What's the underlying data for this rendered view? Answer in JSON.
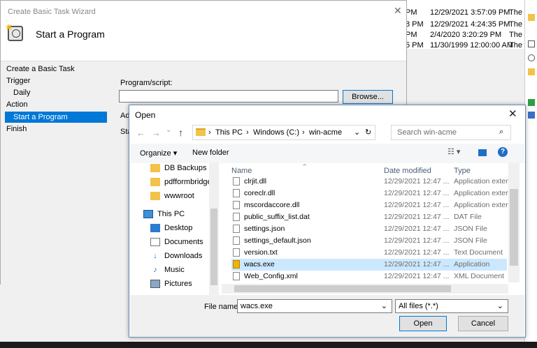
{
  "background": {
    "rows": [
      {
        "c1": "PM",
        "c2": "12/29/2021 3:57:09 PM",
        "c3": "The"
      },
      {
        "c1": "8 PM",
        "c2": "12/29/2021 4:24:35 PM",
        "c3": "The"
      },
      {
        "c1": "PM",
        "c2": "2/4/2020 3:20:29 PM",
        "c3": "The"
      },
      {
        "c1": "5 PM",
        "c2": "11/30/1999 12:00:00 AM",
        "c3": "The"
      }
    ]
  },
  "wizard": {
    "title": "Create Basic Task Wizard",
    "close": "✕",
    "header": "Start a Program",
    "nav": {
      "create": "Create a Basic Task",
      "trigger": "Trigger",
      "daily": "Daily",
      "action": "Action",
      "start": "Start a Program",
      "finish": "Finish"
    },
    "program_label": "Program/script:",
    "program_value": "",
    "browse": "Browse...",
    "ad": "Ad",
    "sta": "Sta"
  },
  "open_dialog": {
    "title": "Open",
    "close": "✕",
    "breadcrumb": [
      "This PC",
      "Windows (C:)",
      "win-acme"
    ],
    "search_placeholder": "Search win-acme",
    "organize": "Organize ▾",
    "new_folder": "New folder",
    "left_items": [
      {
        "label": "DB Backups",
        "icon": "folder-icon"
      },
      {
        "label": "pdfformbridge.v",
        "icon": "folder-icon"
      },
      {
        "label": "wwwroot",
        "icon": "folder-icon"
      },
      {
        "label": "This PC",
        "icon": "computer-icon"
      },
      {
        "label": "Desktop",
        "icon": "desktop-icon"
      },
      {
        "label": "Documents",
        "icon": "documents-icon"
      },
      {
        "label": "Downloads",
        "icon": "downloads-icon"
      },
      {
        "label": "Music",
        "icon": "music-icon"
      },
      {
        "label": "Pictures",
        "icon": "pictures-icon"
      }
    ],
    "columns": {
      "name": "Name",
      "date": "Date modified",
      "type": "Type"
    },
    "files": [
      {
        "name": "clrjit.dll",
        "date": "12/29/2021 12:47 ...",
        "type": "Application exten"
      },
      {
        "name": "coreclr.dll",
        "date": "12/29/2021 12:47 ...",
        "type": "Application exten"
      },
      {
        "name": "mscordaccore.dll",
        "date": "12/29/2021 12:47 ...",
        "type": "Application exten"
      },
      {
        "name": "public_suffix_list.dat",
        "date": "12/29/2021 12:47 ...",
        "type": "DAT File"
      },
      {
        "name": "settings.json",
        "date": "12/29/2021 12:47 ...",
        "type": "JSON File"
      },
      {
        "name": "settings_default.json",
        "date": "12/29/2021 12:47 ...",
        "type": "JSON File"
      },
      {
        "name": "version.txt",
        "date": "12/29/2021 12:47 ...",
        "type": "Text Document"
      },
      {
        "name": "wacs.exe",
        "date": "12/29/2021 12:47 ...",
        "type": "Application"
      },
      {
        "name": "Web_Config.xml",
        "date": "12/29/2021 12:47 ...",
        "type": "XML Document"
      }
    ],
    "file_name_label": "File name:",
    "file_name_value": "wacs.exe",
    "file_type": "All files (*.*)",
    "open_btn": "Open",
    "cancel_btn": "Cancel"
  }
}
